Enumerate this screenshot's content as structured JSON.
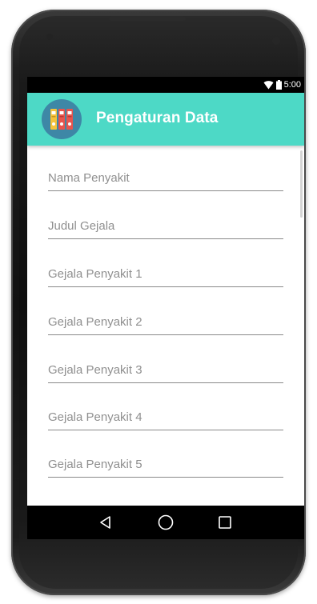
{
  "status_bar": {
    "time": "5:00",
    "icons": [
      "wifi-icon",
      "battery-icon"
    ]
  },
  "app_bar": {
    "title": "Pengaturan Data",
    "logo_icon": "binders-icon",
    "background_color": "#4dd9c6",
    "logo_color": "#3e87a6"
  },
  "form": {
    "fields": [
      {
        "placeholder": "Nama Penyakit",
        "value": ""
      },
      {
        "placeholder": "Judul Gejala",
        "value": ""
      },
      {
        "placeholder": "Gejala Penyakit 1",
        "value": ""
      },
      {
        "placeholder": "Gejala Penyakit 2",
        "value": ""
      },
      {
        "placeholder": "Gejala Penyakit 3",
        "value": ""
      },
      {
        "placeholder": "Gejala Penyakit 4",
        "value": ""
      },
      {
        "placeholder": "Gejala Penyakit 5",
        "value": ""
      }
    ]
  },
  "nav_bar": {
    "buttons": [
      "back-icon",
      "home-icon",
      "recents-icon"
    ]
  }
}
